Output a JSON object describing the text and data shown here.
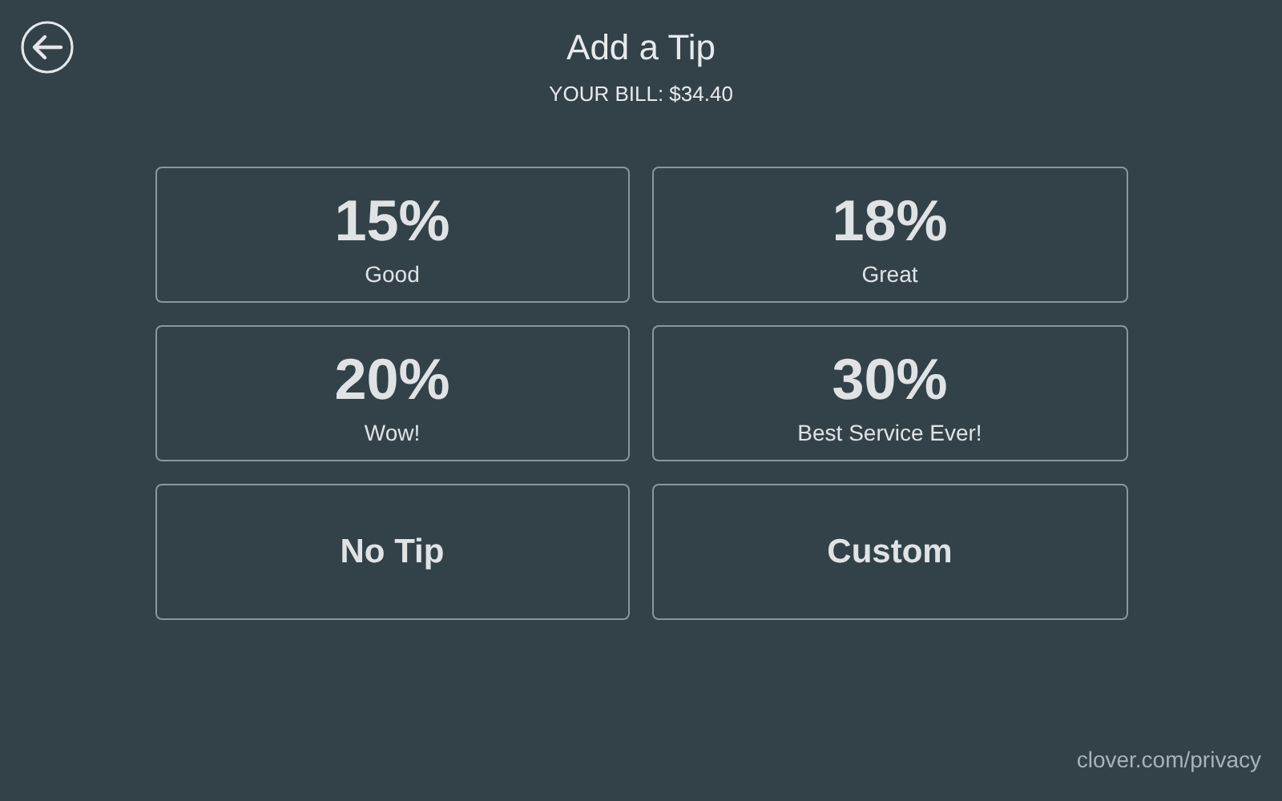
{
  "header": {
    "title": "Add a Tip",
    "bill": "YOUR BILL: $34.40"
  },
  "options": [
    {
      "kind": "percent",
      "value": "15%",
      "label": "Good"
    },
    {
      "kind": "percent",
      "value": "18%",
      "label": "Great"
    },
    {
      "kind": "percent",
      "value": "20%",
      "label": "Wow!"
    },
    {
      "kind": "percent",
      "value": "30%",
      "label": "Best Service Ever!"
    },
    {
      "kind": "plain",
      "value": "No Tip"
    },
    {
      "kind": "plain",
      "value": "Custom"
    }
  ],
  "footer": {
    "link": "clover.com/privacy"
  }
}
